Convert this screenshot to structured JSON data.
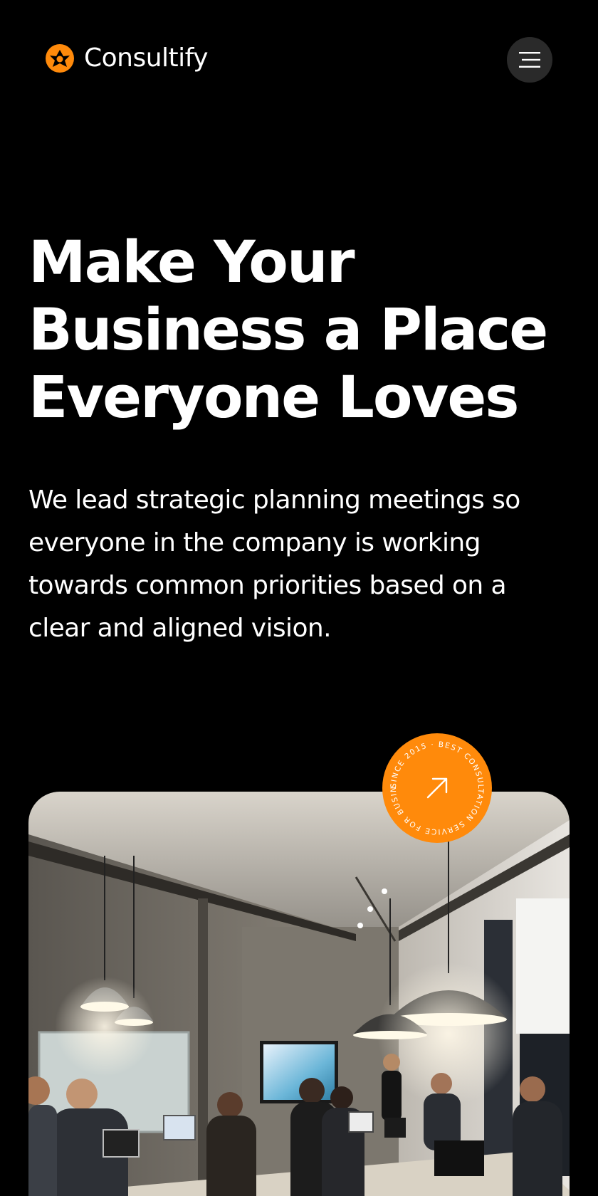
{
  "header": {
    "brand_name": "Consultify",
    "logo_icon": "consultify-logo-icon",
    "menu_icon": "hamburger-menu-icon"
  },
  "hero": {
    "title_lines": [
      "Make Your",
      "Business a Place",
      "Everyone Loves"
    ],
    "description": "We lead strategic planning meetings so everyone in the company is working towards common priorities based on a clear and aligned vision."
  },
  "badge": {
    "circular_text": "SINCE 2015 · BEST CONSULTATION SERVICE FOR BUSINESS ·",
    "icon": "arrow-up-right-icon"
  },
  "photo": {
    "subject": "meeting-room-photo"
  },
  "colors": {
    "background": "#000000",
    "accent": "#ff8a0b",
    "text": "#ffffff",
    "menu_button": "#2a2a2a"
  }
}
